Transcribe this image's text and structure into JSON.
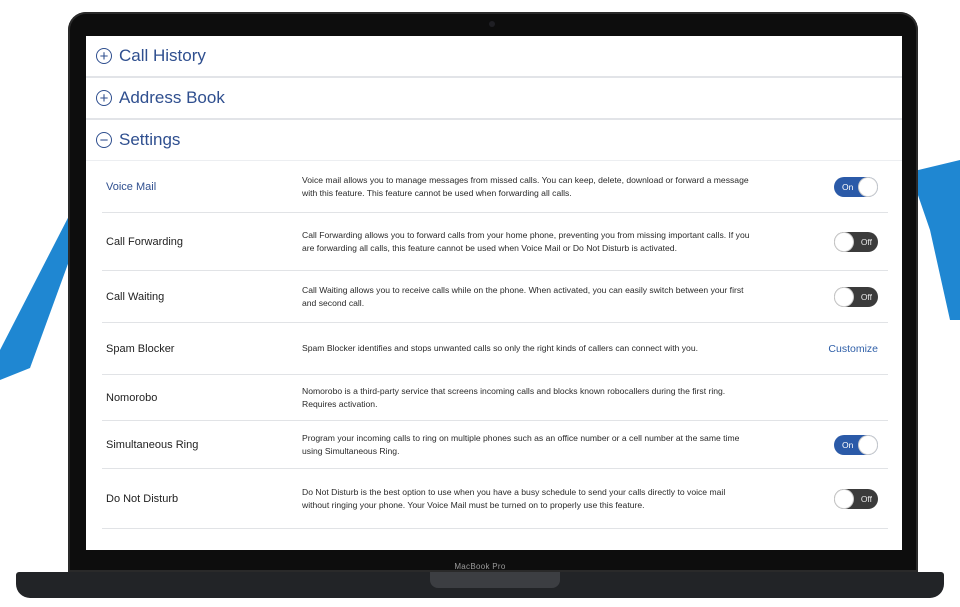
{
  "device": {
    "brand_label": "MacBook Pro"
  },
  "colors": {
    "accent": "#2f4f8f",
    "toggle_on": "#2b5aa8",
    "toggle_off": "#3b3b3b",
    "link": "#2f5fa8",
    "swoosh": "#1f87d2"
  },
  "sections": {
    "call_history": {
      "label": "Call History",
      "icon": "plus-circle-icon",
      "expanded": false
    },
    "address_book": {
      "label": "Address Book",
      "icon": "plus-circle-icon",
      "expanded": false
    },
    "settings": {
      "label": "Settings",
      "icon": "minus-circle-icon",
      "expanded": true
    }
  },
  "settings": {
    "rows": [
      {
        "name": "Voice Mail",
        "description": "Voice mail allows you to manage messages from missed calls. You can keep, delete, download or forward a message with this feature. This feature cannot be used when forwarding all calls.",
        "control": "toggle",
        "state": "On"
      },
      {
        "name": "Call Forwarding",
        "description": "Call Forwarding allows you to forward calls from your home phone, preventing you from missing important calls. If you are forwarding all calls, this feature cannot be used when Voice Mail or Do Not Disturb is activated.",
        "control": "toggle",
        "state": "Off"
      },
      {
        "name": "Call Waiting",
        "description": "Call Waiting allows you to receive calls while on the phone. When activated, you can easily switch between your first and second call.",
        "control": "toggle",
        "state": "Off"
      },
      {
        "name": "Spam Blocker",
        "description": "Spam Blocker identifies and stops unwanted calls so only the right kinds of callers can connect with you.",
        "control": "link",
        "link_label": "Customize"
      },
      {
        "name": "Nomorobo",
        "description": "Nomorobo is a third-party service that screens incoming calls and blocks known robocallers during the first ring. Requires activation.",
        "control": "none"
      },
      {
        "name": "Simultaneous Ring",
        "description": "Program your incoming calls to ring on multiple phones such as an office number or a cell number at the same time using Simultaneous Ring.",
        "control": "toggle",
        "state": "On"
      },
      {
        "name": "Do Not Disturb",
        "description": "Do Not Disturb is the best option to use when you have a busy schedule to send your calls directly to voice mail without ringing your phone. Your Voice Mail must be turned on to properly use this feature.",
        "control": "toggle",
        "state": "Off"
      }
    ]
  }
}
